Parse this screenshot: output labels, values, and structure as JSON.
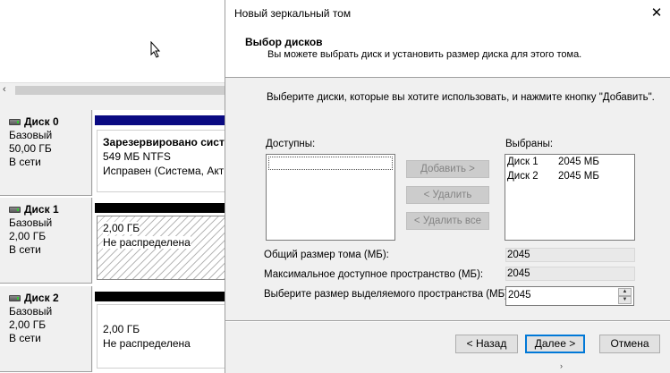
{
  "background": {
    "scroll_left_arrow": "‹",
    "scroll_right_arrow": "›",
    "disks": [
      {
        "name": "Диск 0",
        "type": "Базовый",
        "size": "50,00 ГБ",
        "status": "В сети",
        "bar_color": "#0a0a82",
        "volume": {
          "title": "Зарезервировано систем",
          "size": "549 МБ NTFS",
          "state": "Исправен (Система, Акти"
        }
      },
      {
        "name": "Диск 1",
        "type": "Базовый",
        "size": "2,00 ГБ",
        "status": "В сети",
        "bar_color": "#000000",
        "volume": {
          "size": "2,00 ГБ",
          "state": "Не распределена"
        }
      },
      {
        "name": "Диск 2",
        "type": "Базовый",
        "size": "2,00 ГБ",
        "status": "В сети",
        "bar_color": "#000000",
        "volume": {
          "size": "2,00 ГБ",
          "state": "Не распределена"
        }
      }
    ]
  },
  "dialog": {
    "title": "Новый зеркальный том",
    "close_glyph": "✕",
    "header_title": "Выбор дисков",
    "header_subtitle": "Вы можете выбрать диск и установить размер диска для этого тома.",
    "instruction": "Выберите диски, которые вы хотите использовать, и нажмите кнопку \"Добавить\".",
    "available_label": "Доступны:",
    "selected_label": "Выбраны:",
    "selected_disks": [
      {
        "name": "Диск 1",
        "size": "2045 МБ"
      },
      {
        "name": "Диск 2",
        "size": "2045 МБ"
      }
    ],
    "add_button": "Добавить >",
    "remove_button": "< Удалить",
    "remove_all_button": "< Удалить все",
    "total_size_label": "Общий размер тома (МБ):",
    "total_size_value": "2045",
    "max_space_label": "Максимальное доступное пространство (МБ):",
    "max_space_value": "2045",
    "alloc_label": "Выберите размер выделяемого пространства (МБ):",
    "alloc_value": "2045",
    "back_button": "< Назад",
    "next_button": "Далее >",
    "cancel_button": "Отмена"
  }
}
